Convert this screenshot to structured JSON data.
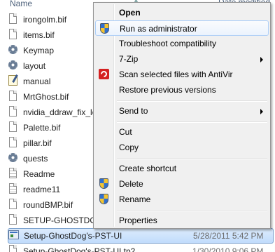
{
  "header": {
    "name_label": "Name",
    "date_label": "Date modified"
  },
  "files": [
    {
      "name": "irongolm.bif",
      "icon": "document-icon",
      "date": ""
    },
    {
      "name": "items.bif",
      "icon": "document-icon",
      "date": ""
    },
    {
      "name": "Keymap",
      "icon": "settings-file-icon",
      "date": ""
    },
    {
      "name": "layout",
      "icon": "settings-file-icon",
      "date": ""
    },
    {
      "name": "manual",
      "icon": "notepad-icon",
      "date": ""
    },
    {
      "name": "MrtGhost.bif",
      "icon": "document-icon",
      "date": ""
    },
    {
      "name": "nvidia_ddraw_fix_lo",
      "icon": "document-icon",
      "date": ""
    },
    {
      "name": "Palette.bif",
      "icon": "document-icon",
      "date": ""
    },
    {
      "name": "pillar.bif",
      "icon": "document-icon",
      "date": ""
    },
    {
      "name": "quests",
      "icon": "settings-file-icon",
      "date": ""
    },
    {
      "name": "Readme",
      "icon": "text-document-icon",
      "date": ""
    },
    {
      "name": "readme11",
      "icon": "text-document-icon",
      "date": ""
    },
    {
      "name": "roundBMP.bif",
      "icon": "document-icon",
      "date": ""
    },
    {
      "name": "SETUP-GHOSTDOG",
      "icon": "document-icon",
      "date": ""
    },
    {
      "name": "Setup-GhostDog's-PST-UI",
      "icon": "executable-icon",
      "date": "5/28/2011 5:42 PM",
      "selected": true
    },
    {
      "name": "Setup-GhostDog's-PST-UI.tp2",
      "icon": "document-icon",
      "date": "1/30/2010 9:06 PM"
    }
  ],
  "context_menu": {
    "open": "Open",
    "run_as_admin": "Run as administrator",
    "troubleshoot": "Troubleshoot compatibility",
    "seven_zip": "7-Zip",
    "scan_antivir": "Scan selected files with AntiVir",
    "restore": "Restore previous versions",
    "send_to": "Send to",
    "cut": "Cut",
    "copy": "Copy",
    "create_shortcut": "Create shortcut",
    "delete": "Delete",
    "rename": "Rename",
    "properties": "Properties"
  },
  "colors": {
    "selection_fill": "#c1dcfc",
    "selection_border": "#7da2ce",
    "menu_background": "#f0f0f0",
    "menu_hover_border": "#aecff7",
    "header_text": "#4c607a"
  }
}
